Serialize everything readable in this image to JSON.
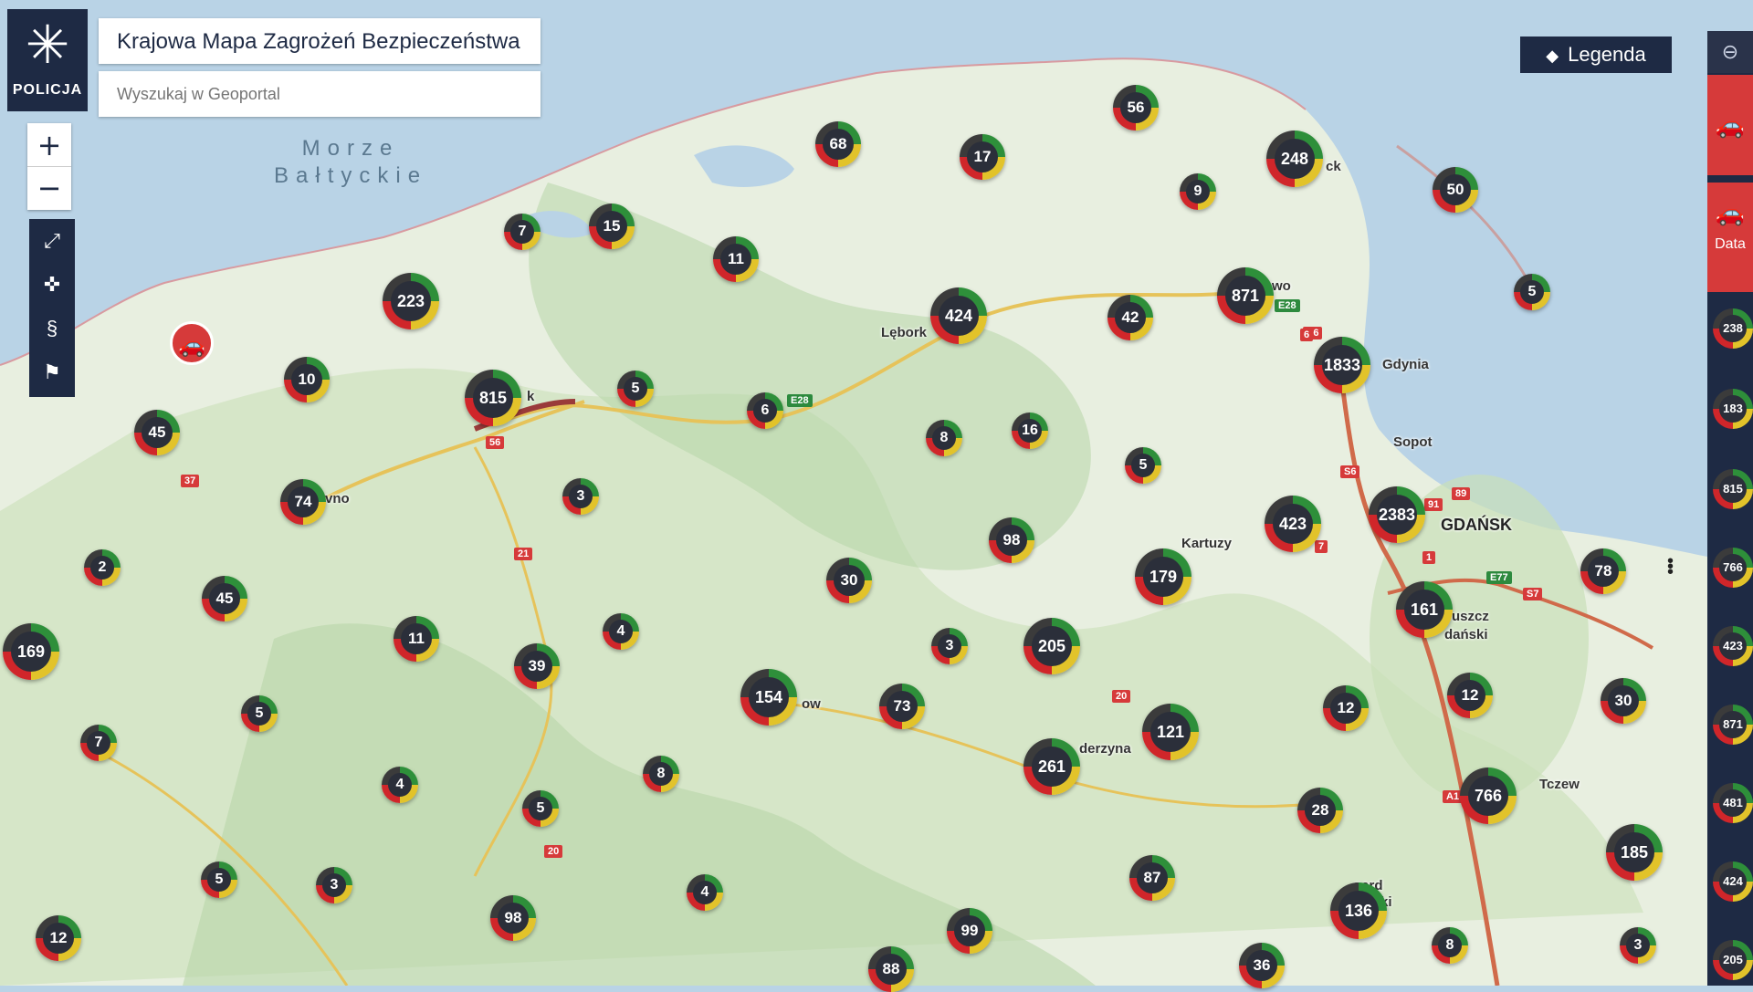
{
  "header": {
    "logo_label": "POLICJA",
    "title": "Krajowa Mapa Zagrożeń Bezpieczeństwa",
    "search_placeholder": "Wyszukaj w Geoportal"
  },
  "legend_button": {
    "label": "Legenda"
  },
  "sea_label": {
    "line1": "Morze",
    "line2": "Bałtyckie"
  },
  "places": [
    {
      "name": "Lębork"
    },
    {
      "name": "Gdynia"
    },
    {
      "name": "Sopot"
    },
    {
      "name": "GDAŃSK"
    },
    {
      "name": "Kartuzy"
    },
    {
      "name": "Tczew"
    },
    {
      "name": "uszcz"
    },
    {
      "name": "dański"
    },
    {
      "name": "derzyna"
    },
    {
      "name": "vno"
    },
    {
      "name": "ck"
    },
    {
      "name": "wo"
    },
    {
      "name": "ow"
    },
    {
      "name": "k"
    },
    {
      "name": "gard"
    },
    {
      "name": "ki"
    }
  ],
  "roads": [
    "56",
    "37",
    "21",
    "20",
    "20",
    "S6",
    "S6",
    "91",
    "89",
    "7",
    "1",
    "E77",
    "S7",
    "E28",
    "E28",
    "A1",
    "6"
  ],
  "markers": [
    {
      "count": "68"
    },
    {
      "count": "17"
    },
    {
      "count": "56"
    },
    {
      "count": "248"
    },
    {
      "count": "50"
    },
    {
      "count": "9"
    },
    {
      "count": "5"
    },
    {
      "count": "15"
    },
    {
      "count": "7"
    },
    {
      "count": "11"
    },
    {
      "count": "223"
    },
    {
      "count": "424"
    },
    {
      "count": "42"
    },
    {
      "count": "871"
    },
    {
      "count": "1833"
    },
    {
      "count": "10"
    },
    {
      "count": "815"
    },
    {
      "count": "5"
    },
    {
      "count": "6"
    },
    {
      "count": "45"
    },
    {
      "count": "8"
    },
    {
      "count": "16"
    },
    {
      "count": "5"
    },
    {
      "count": "74"
    },
    {
      "count": "3"
    },
    {
      "count": "423"
    },
    {
      "count": "2383"
    },
    {
      "count": "98"
    },
    {
      "count": "2"
    },
    {
      "count": "30"
    },
    {
      "count": "179"
    },
    {
      "count": "78"
    },
    {
      "count": "45"
    },
    {
      "count": "161"
    },
    {
      "count": "169"
    },
    {
      "count": "11"
    },
    {
      "count": "4"
    },
    {
      "count": "3"
    },
    {
      "count": "205"
    },
    {
      "count": "39"
    },
    {
      "count": "154"
    },
    {
      "count": "73"
    },
    {
      "count": "12"
    },
    {
      "count": "12"
    },
    {
      "count": "30"
    },
    {
      "count": "5"
    },
    {
      "count": "121"
    },
    {
      "count": "7"
    },
    {
      "count": "261"
    },
    {
      "count": "4"
    },
    {
      "count": "8"
    },
    {
      "count": "5"
    },
    {
      "count": "28"
    },
    {
      "count": "766"
    },
    {
      "count": "185"
    },
    {
      "count": "5"
    },
    {
      "count": "3"
    },
    {
      "count": "87"
    },
    {
      "count": "98"
    },
    {
      "count": "4"
    },
    {
      "count": "99"
    },
    {
      "count": "136"
    },
    {
      "count": "12"
    },
    {
      "count": "8"
    },
    {
      "count": "88"
    },
    {
      "count": "36"
    },
    {
      "count": "3"
    }
  ],
  "right_panel": {
    "data_label": "Data",
    "items": [
      "238",
      "183",
      "815",
      "766",
      "423",
      "871",
      "481",
      "424",
      "205"
    ]
  },
  "colors": {
    "panel": "#1e2a44",
    "accent_red": "#d63a3a",
    "water": "#b9d3e6",
    "land": "#e8efe0",
    "forest": "#b7d5a8"
  },
  "icons": [
    "police-logo-icon",
    "plus-icon",
    "minus-icon",
    "fullscreen-icon",
    "locate-icon",
    "paragraph-icon",
    "tag-icon",
    "layers-icon",
    "car-icon",
    "more-icon"
  ]
}
